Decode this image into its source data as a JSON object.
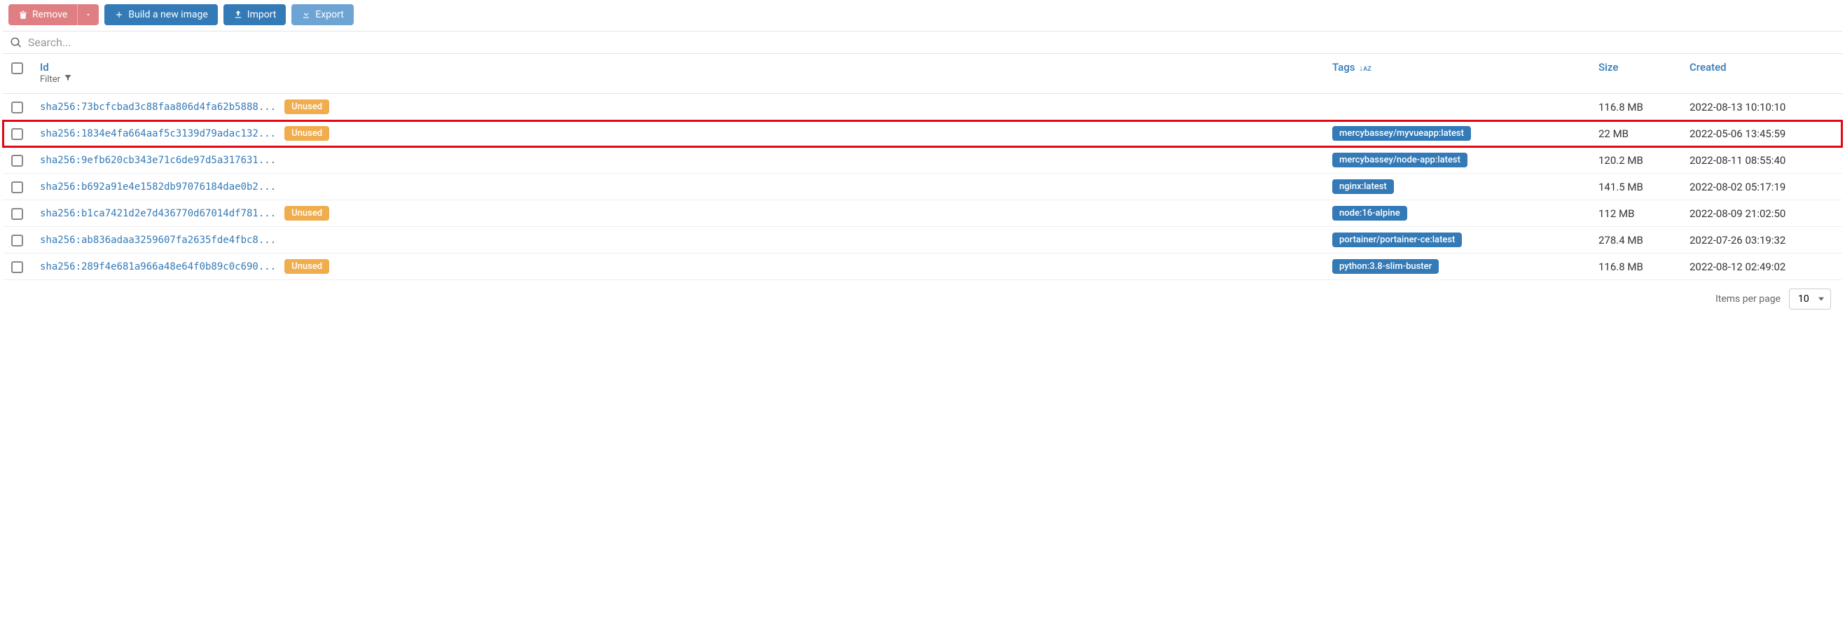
{
  "toolbar": {
    "remove_label": "Remove",
    "build_label": "Build a new image",
    "import_label": "Import",
    "export_label": "Export"
  },
  "search": {
    "placeholder": "Search..."
  },
  "columns": {
    "id": "Id",
    "filter": "Filter",
    "tags": "Tags",
    "size": "Size",
    "created": "Created"
  },
  "badges": {
    "unused": "Unused"
  },
  "rows": [
    {
      "id": "sha256:73bcfcbad3c88faa806d4fa62b5888...",
      "unused": true,
      "tags": [],
      "size": "116.8 MB",
      "created": "2022-08-13 10:10:10",
      "highlight": false
    },
    {
      "id": "sha256:1834e4fa664aaf5c3139d79adac132...",
      "unused": true,
      "tags": [
        "mercybassey/myvueapp:latest"
      ],
      "size": "22 MB",
      "created": "2022-05-06 13:45:59",
      "highlight": true
    },
    {
      "id": "sha256:9efb620cb343e71c6de97d5a317631...",
      "unused": false,
      "tags": [
        "mercybassey/node-app:latest"
      ],
      "size": "120.2 MB",
      "created": "2022-08-11 08:55:40",
      "highlight": false
    },
    {
      "id": "sha256:b692a91e4e1582db97076184dae0b2...",
      "unused": false,
      "tags": [
        "nginx:latest"
      ],
      "size": "141.5 MB",
      "created": "2022-08-02 05:17:19",
      "highlight": false
    },
    {
      "id": "sha256:b1ca7421d2e7d436770d67014df781...",
      "unused": true,
      "tags": [
        "node:16-alpine"
      ],
      "size": "112 MB",
      "created": "2022-08-09 21:02:50",
      "highlight": false
    },
    {
      "id": "sha256:ab836adaa3259607fa2635fde4fbc8...",
      "unused": false,
      "tags": [
        "portainer/portainer-ce:latest"
      ],
      "size": "278.4 MB",
      "created": "2022-07-26 03:19:32",
      "highlight": false
    },
    {
      "id": "sha256:289f4e681a966a48e64f0b89c0c690...",
      "unused": true,
      "tags": [
        "python:3.8-slim-buster"
      ],
      "size": "116.8 MB",
      "created": "2022-08-12 02:49:02",
      "highlight": false
    }
  ],
  "footer": {
    "items_per_page_label": "Items per page",
    "items_per_page_value": "10"
  }
}
